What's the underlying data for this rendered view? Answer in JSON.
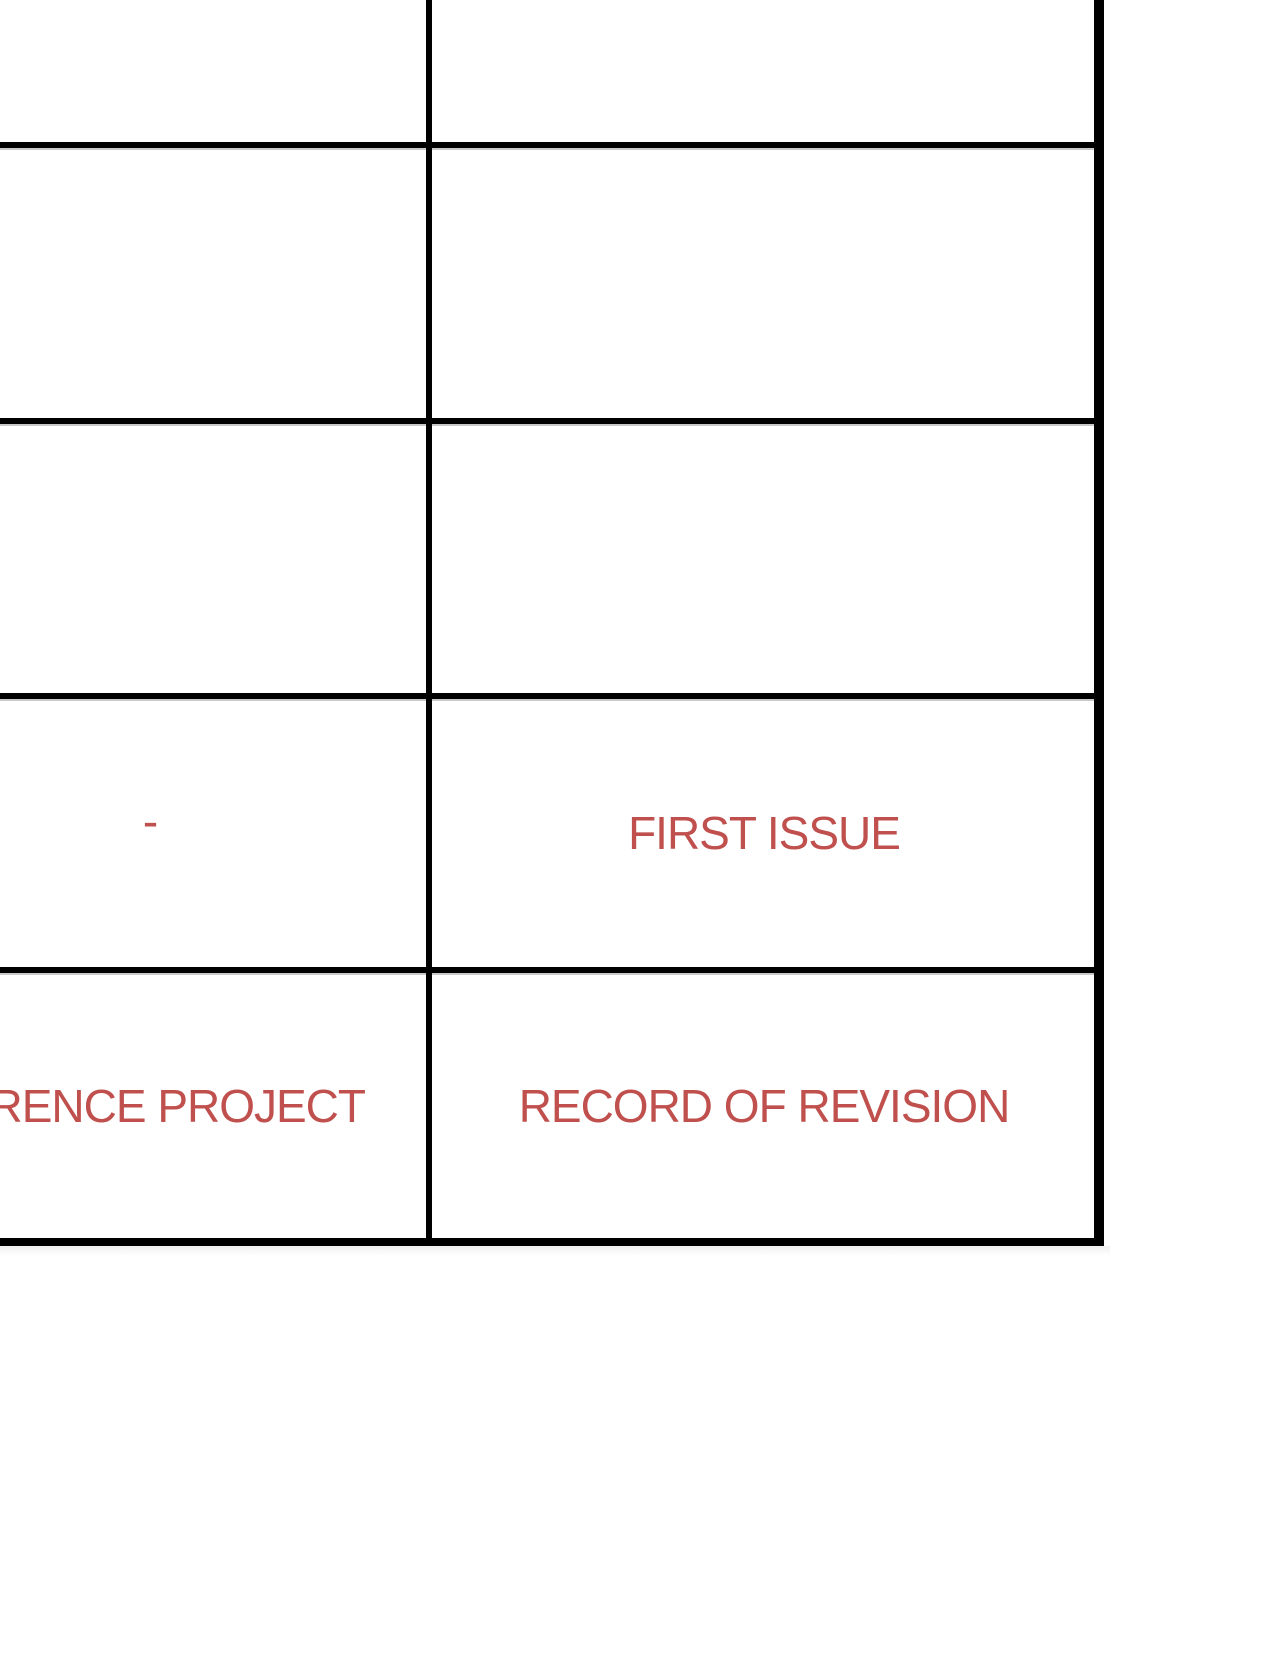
{
  "revision_table": {
    "rows": [
      {
        "reference_project": "",
        "record_of_revision": ""
      },
      {
        "reference_project": "",
        "record_of_revision": ""
      },
      {
        "reference_project": "",
        "record_of_revision": ""
      },
      {
        "reference_project": "-",
        "record_of_revision": "FIRST ISSUE"
      }
    ],
    "header": {
      "reference_project": "FERENCE PROJECT",
      "record_of_revision": "RECORD OF REVISION"
    }
  },
  "colors": {
    "text": "#c0504d",
    "rule": "#000000"
  }
}
